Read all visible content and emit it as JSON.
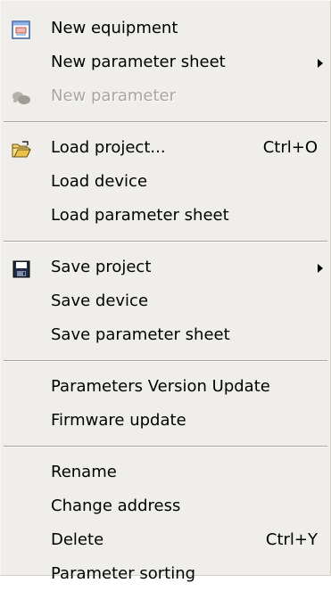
{
  "menu": {
    "items": [
      {
        "label": "New equipment",
        "icon": "new-equipment-icon"
      },
      {
        "label": "New parameter sheet",
        "submenu": true
      },
      {
        "label": "New parameter",
        "icon": "new-parameter-icon",
        "disabled": true
      },
      {
        "label": "Load project...",
        "shortcut": "Ctrl+O",
        "icon": "open-folder-icon"
      },
      {
        "label": "Load device"
      },
      {
        "label": "Load parameter sheet"
      },
      {
        "label": "Save project",
        "icon": "floppy-disk-icon",
        "submenu": true
      },
      {
        "label": "Save device"
      },
      {
        "label": "Save parameter sheet"
      },
      {
        "label": "Parameters Version Update"
      },
      {
        "label": "Firmware update"
      },
      {
        "label": "Rename"
      },
      {
        "label": "Change address"
      },
      {
        "label": "Delete",
        "shortcut": "Ctrl+Y"
      },
      {
        "label": "Parameter sorting"
      }
    ]
  }
}
